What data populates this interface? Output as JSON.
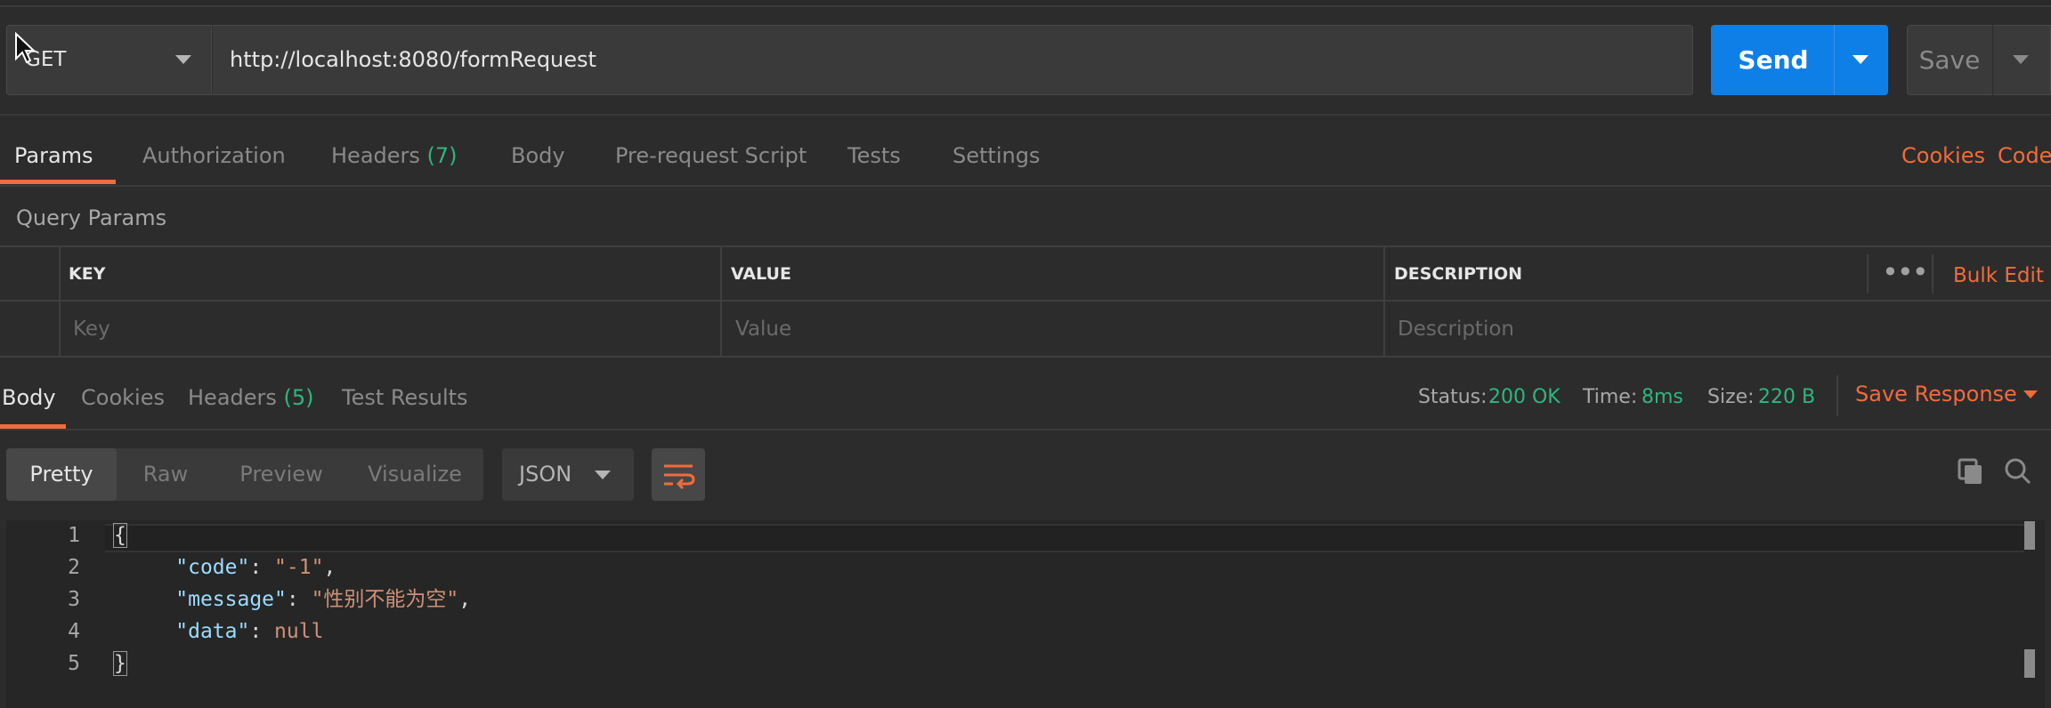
{
  "request": {
    "method": "GET",
    "url": "http://localhost:8080/formRequest",
    "send_label": "Send",
    "save_label": "Save"
  },
  "request_tabs": [
    {
      "label": "Params",
      "active": true
    },
    {
      "label": "Authorization"
    },
    {
      "label": "Headers",
      "count": "(7)"
    },
    {
      "label": "Body"
    },
    {
      "label": "Pre-request Script"
    },
    {
      "label": "Tests"
    },
    {
      "label": "Settings"
    }
  ],
  "right_links": {
    "cookies": "Cookies",
    "code": "Code"
  },
  "query_params": {
    "title": "Query Params",
    "columns": [
      "KEY",
      "VALUE",
      "DESCRIPTION"
    ],
    "placeholders": {
      "key": "Key",
      "value": "Value",
      "description": "Description"
    },
    "bulk_edit": "Bulk Edit"
  },
  "response_tabs": [
    {
      "label": "Body",
      "active": true
    },
    {
      "label": "Cookies"
    },
    {
      "label": "Headers",
      "count": "(5)"
    },
    {
      "label": "Test Results"
    }
  ],
  "response_meta": {
    "status_label": "Status:",
    "status_value": "200 OK",
    "time_label": "Time:",
    "time_value": "8ms",
    "size_label": "Size:",
    "size_value": "220 B",
    "save_response": "Save Response"
  },
  "view_modes": [
    "Pretty",
    "Raw",
    "Preview",
    "Visualize"
  ],
  "format": "JSON",
  "code_lines": [
    {
      "n": "1"
    },
    {
      "n": "2"
    },
    {
      "n": "3"
    },
    {
      "n": "4"
    },
    {
      "n": "5"
    }
  ],
  "json": {
    "open": "{",
    "close": "}",
    "code_key": "\"code\"",
    "code_val": "\"-1\"",
    "message_key": "\"message\"",
    "message_val": "\"性别不能为空\"",
    "data_key": "\"data\"",
    "data_val": "null"
  },
  "colors": {
    "accent": "#f26b3a",
    "send": "#0f7fe8",
    "success": "#2fb67f"
  }
}
